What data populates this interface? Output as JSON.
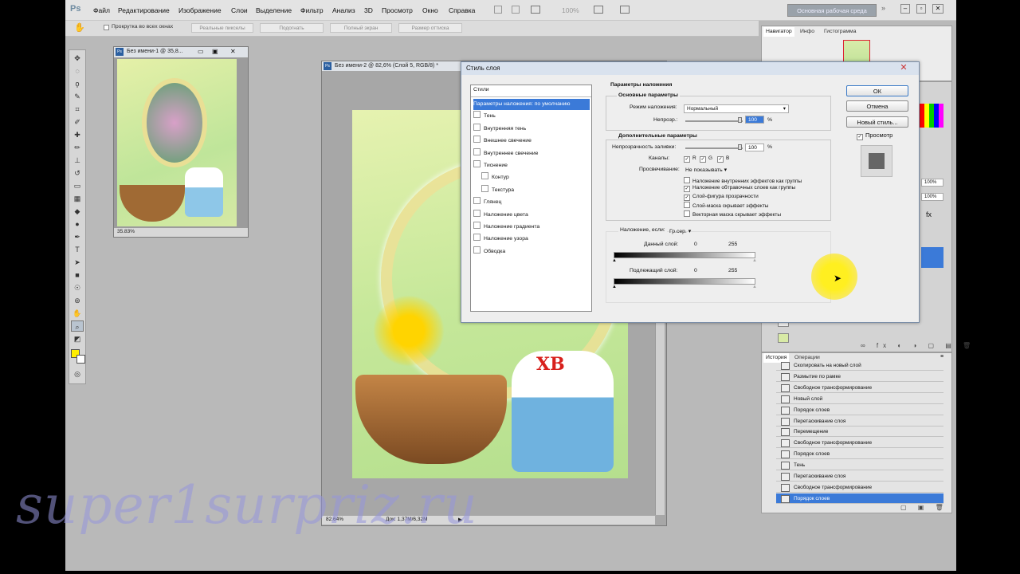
{
  "app": {
    "logo": "Ps",
    "menu": [
      "Файл",
      "Редактирование",
      "Изображение",
      "Слои",
      "Выделение",
      "Фильтр",
      "Анализ",
      "3D",
      "Просмотр",
      "Окно",
      "Справка"
    ],
    "zoom_display": "100%",
    "workspace_label": "Основная рабочая среда"
  },
  "options_bar": {
    "scroll_all_windows": "Прокрутка во всех окнах",
    "buttons": [
      "Реальные пикселы",
      "Подогнать",
      "Полный экран",
      "Размер оттиска"
    ]
  },
  "doc1": {
    "title": "Без имени-1 @ 35,8...",
    "zoom": "35.83%"
  },
  "doc2": {
    "title": "Без имени-2 @ 82,6% (Слой 5, RGB/8) *",
    "zoom": "82.64%",
    "doc_info": "Док: 1,37M/6,32M"
  },
  "dialog": {
    "title": "Стиль слоя",
    "styles_header": "Стили",
    "styles": [
      {
        "label": "Параметры наложения: по умолчанию",
        "active": true
      },
      {
        "label": "Тень"
      },
      {
        "label": "Внутренняя тень"
      },
      {
        "label": "Внешнее свечение"
      },
      {
        "label": "Внутреннее свечение"
      },
      {
        "label": "Тиснение"
      },
      {
        "label": "Контур",
        "indent": true
      },
      {
        "label": "Текстура",
        "indent": true
      },
      {
        "label": "Глянец"
      },
      {
        "label": "Наложение цвета"
      },
      {
        "label": "Наложение градиента"
      },
      {
        "label": "Наложение узора"
      },
      {
        "label": "Обводка"
      }
    ],
    "blend_params": "Параметры наложения",
    "basic_params": "Основные параметры",
    "blend_mode_label": "Режим наложения:",
    "blend_mode_value": "Нормальный",
    "opacity_label": "Непрозр.:",
    "opacity_value": "100",
    "percent": "%",
    "advanced_params": "Дополнительные параметры",
    "fill_opacity_label": "Непрозрачность заливки:",
    "fill_opacity_value": "100",
    "channels_label": "Каналы:",
    "channels": [
      "R",
      "G",
      "B"
    ],
    "knockout_label": "Просвечивание:",
    "knockout_value": "Не показывать",
    "options": [
      {
        "label": "Наложение внутренних эффектов как группы",
        "checked": false
      },
      {
        "label": "Наложение обтравочных слоев как группы",
        "checked": true
      },
      {
        "label": "Слой-фигура прозрачности",
        "checked": true
      },
      {
        "label": "Слой-маска скрывает эффекты",
        "checked": false
      },
      {
        "label": "Векторная маска скрывает эффекты",
        "checked": false
      }
    ],
    "blend_if_label": "Наложение, если:",
    "blend_if_value": "Гр.сер.",
    "this_layer_label": "Данный слой:",
    "this_layer_min": "0",
    "this_layer_max": "255",
    "underlying_label": "Подлежащий слой:",
    "underlying_min": "0",
    "underlying_max": "255",
    "ok": "ОК",
    "cancel": "Отмена",
    "new_style": "Новый стиль...",
    "preview": "Просмотр"
  },
  "panels": {
    "navigator_tabs": [
      "Навигатор",
      "Инфо",
      "Гистограмма"
    ],
    "layers_opacity_1": "100%",
    "layers_opacity_2": "100%",
    "history_tabs": [
      "История",
      "Операции"
    ],
    "history": [
      "Скопировать на новый слой",
      "Размытие по рамке",
      "Свободное трансформирование",
      "Новый слой",
      "Порядок слоев",
      "Перетаскивание слоя",
      "Перемещение",
      "Свободное трансформирование",
      "Порядок слоев",
      "Тень",
      "Перетаскивание слоя",
      "Свободное трансформирование",
      "Порядок слоев"
    ]
  },
  "canvas": {
    "cake_label": "ХВ"
  },
  "watermark": "super1surpriz.ru",
  "colors": {
    "accent": "#3b7ad8",
    "foreground_swatch": "#ffee00"
  }
}
